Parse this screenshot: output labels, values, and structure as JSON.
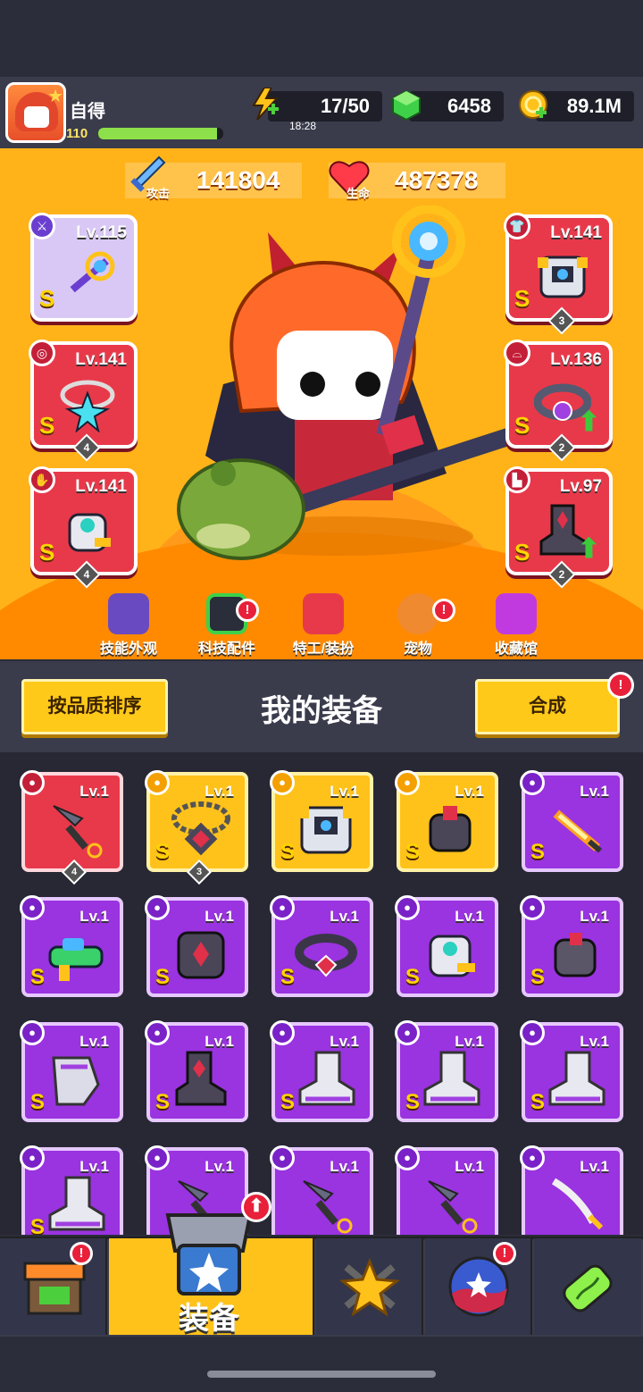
{
  "player": {
    "name": "自得",
    "level": "110",
    "xp_fraction": 0.95
  },
  "resources": {
    "energy": "17/50",
    "energy_timer": "18:28",
    "gems": "6458",
    "gold": "89.1M"
  },
  "stats": {
    "attack_label": "攻击",
    "attack": "141804",
    "hp_label": "生命",
    "hp": "487378"
  },
  "equipped": {
    "weapon": {
      "level": "Lv.115",
      "grade": "S"
    },
    "necklace": {
      "level": "Lv.141",
      "grade": "S",
      "stars": "4"
    },
    "gloves": {
      "level": "Lv.141",
      "grade": "S",
      "stars": "4"
    },
    "armor": {
      "level": "Lv.141",
      "grade": "S",
      "stars": "3"
    },
    "belt": {
      "level": "Lv.136",
      "grade": "S",
      "stars": "2"
    },
    "boots": {
      "level": "Lv.97",
      "grade": "S",
      "stars": "2"
    }
  },
  "submenu": [
    "技能外观",
    "科技配件",
    "特工/装扮",
    "宠物",
    "收藏馆"
  ],
  "submenu_badge": "!",
  "equipment_header": {
    "sort_button": "按品质排序",
    "title": "我的装备",
    "merge_button": "合成"
  },
  "inventory": [
    {
      "level": "Lv.1",
      "rarity": "red",
      "grade": "",
      "stars": "4",
      "icon": "kunai-icon"
    },
    {
      "level": "Lv.1",
      "rarity": "gold",
      "grade": "S",
      "stars": "3",
      "icon": "chain-necklace-icon"
    },
    {
      "level": "Lv.1",
      "rarity": "gold",
      "grade": "S",
      "stars": "",
      "icon": "robot-armor-icon"
    },
    {
      "level": "Lv.1",
      "rarity": "gold",
      "grade": "S",
      "stars": "",
      "icon": "gauntlet-icon"
    },
    {
      "level": "Lv.1",
      "rarity": "purple",
      "grade": "S",
      "stars": "",
      "icon": "flame-sword-icon"
    },
    {
      "level": "Lv.1",
      "rarity": "purple",
      "grade": "S",
      "stars": "",
      "icon": "water-gun-icon"
    },
    {
      "level": "Lv.1",
      "rarity": "purple",
      "grade": "S",
      "stars": "",
      "icon": "dark-armor-icon"
    },
    {
      "level": "Lv.1",
      "rarity": "purple",
      "grade": "S",
      "stars": "",
      "icon": "spiked-belt-icon"
    },
    {
      "level": "Lv.1",
      "rarity": "purple",
      "grade": "S",
      "stars": "",
      "icon": "tech-gauntlet-icon"
    },
    {
      "level": "Lv.1",
      "rarity": "purple",
      "grade": "S",
      "stars": "",
      "icon": "claw-gauntlet-icon"
    },
    {
      "level": "Lv.1",
      "rarity": "purple",
      "grade": "S",
      "stars": "",
      "icon": "silver-claw-icon"
    },
    {
      "level": "Lv.1",
      "rarity": "purple",
      "grade": "S",
      "stars": "",
      "icon": "dark-boot-icon"
    },
    {
      "level": "Lv.1",
      "rarity": "purple",
      "grade": "S",
      "stars": "",
      "icon": "sneaker-icon"
    },
    {
      "level": "Lv.1",
      "rarity": "purple",
      "grade": "S",
      "stars": "",
      "icon": "sneaker-icon"
    },
    {
      "level": "Lv.1",
      "rarity": "purple",
      "grade": "S",
      "stars": "",
      "icon": "sneaker-icon"
    },
    {
      "level": "Lv.1",
      "rarity": "purple",
      "grade": "S",
      "stars": "",
      "icon": "sneaker-icon"
    },
    {
      "level": "Lv.1",
      "rarity": "purple",
      "grade": "",
      "stars": "",
      "icon": "kunai-icon"
    },
    {
      "level": "Lv.1",
      "rarity": "purple",
      "grade": "",
      "stars": "",
      "icon": "kunai-icon"
    },
    {
      "level": "Lv.1",
      "rarity": "purple",
      "grade": "",
      "stars": "",
      "icon": "kunai-icon"
    },
    {
      "level": "Lv.1",
      "rarity": "purple",
      "grade": "",
      "stars": "",
      "icon": "katana-icon"
    }
  ],
  "nav": {
    "active_label": "装备",
    "badge": "!"
  },
  "colors": {
    "rarity_red": "#e8394a",
    "rarity_gold": "#ffc21a",
    "rarity_purple": "#9a33e0",
    "accent_yellow": "#ffc919"
  }
}
